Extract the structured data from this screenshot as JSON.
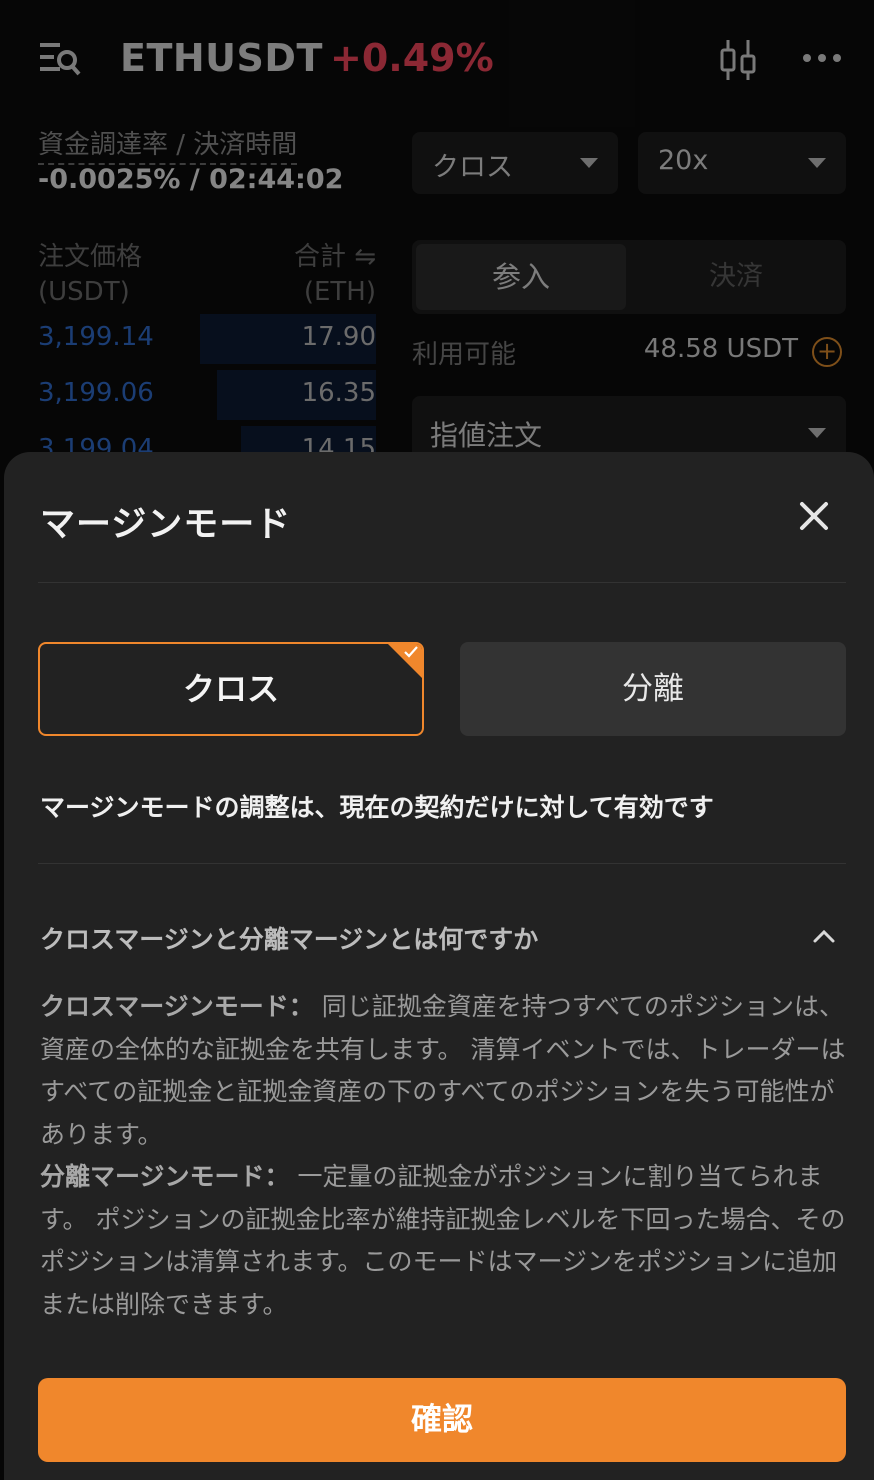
{
  "header": {
    "symbol": "ETHUSDT",
    "change": "+0.49%",
    "menu_icon": "menu-search-icon",
    "chart_icon": "candlestick-icon",
    "more_icon": "more-dots-icon"
  },
  "funding": {
    "label": "資金調達率 / 決済時間",
    "value": "-0.0025% / 02:44:02"
  },
  "selectors": {
    "margin_mode": "クロス",
    "leverage": "20x"
  },
  "orderbook": {
    "price_header": "注文価格\n(USDT)",
    "qty_header": "合計 ⇋\n(ETH)",
    "rows": [
      {
        "price": "3,199.14",
        "qty": "17.90",
        "depth": 0.52
      },
      {
        "price": "3,199.06",
        "qty": "16.35",
        "depth": 0.47
      },
      {
        "price": "3,199.04",
        "qty": "14.15",
        "depth": 0.4
      }
    ]
  },
  "trade_tabs": {
    "open": "参入",
    "close": "決済"
  },
  "available": {
    "label": "利用可能",
    "value": "48.58 USDT",
    "add_icon": "plus-circle-icon"
  },
  "order_type": {
    "value": "指値注文"
  },
  "sheet": {
    "title": "マージンモード",
    "close_icon": "close-icon",
    "modes": [
      {
        "label": "クロス",
        "selected": true
      },
      {
        "label": "分離",
        "selected": false
      }
    ],
    "note": "マージンモードの調整は、現在の契約だけに対して有効です",
    "faq": {
      "question": "クロスマージンと分離マージンとは何ですか",
      "cross_heading": "クロスマージンモード：",
      "cross_body": " 同じ証拠金資産を持つすべてのポジションは、資産の全体的な証拠金を共有します。 清算イベントでは、トレーダーはすべての証拠金と証拠金資産の下のすべてのポジションを失う可能性があります。",
      "isolated_heading": "分離マージンモード：",
      "isolated_body": " 一定量の証拠金がポジションに割り当てられます。 ポジションの証拠金比率が維持証拠金レベルを下回った場合、そのポジションは清算されます。このモードはマージンをポジションに追加または削除できます。"
    },
    "confirm_label": "確認"
  },
  "colors": {
    "accent": "#f0872c",
    "down": "#f0455a",
    "bid_price": "#2f6ac9"
  }
}
